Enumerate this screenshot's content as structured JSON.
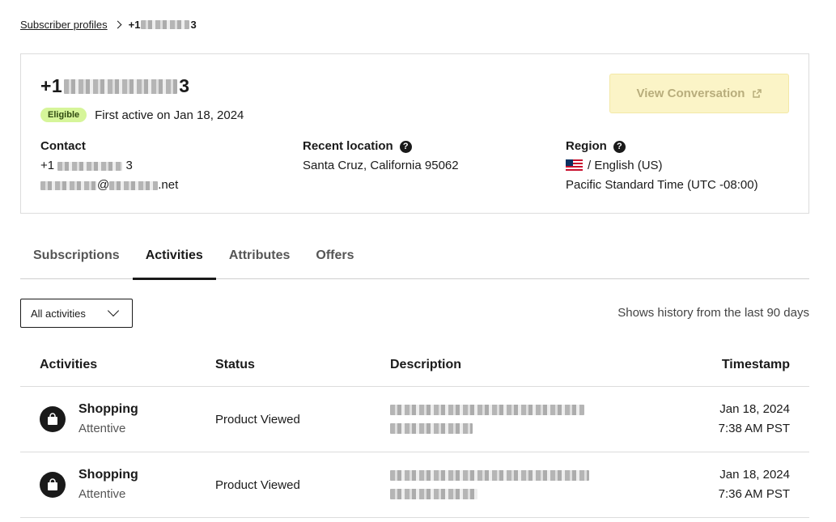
{
  "breadcrumb": {
    "parent": "Subscriber profiles",
    "current_prefix": "+1",
    "current_suffix": "3"
  },
  "profile": {
    "phone_prefix": "+1",
    "phone_suffix": "3",
    "status_badge": "Eligible",
    "first_active": "First active on Jan 18, 2024",
    "view_button": "View Conversation",
    "contact": {
      "heading": "Contact",
      "phone_prefix": "+1",
      "phone_suffix": "3",
      "email_domain": ".net"
    },
    "location": {
      "heading": "Recent location",
      "value": "Santa Cruz, California 95062"
    },
    "region": {
      "heading": "Region",
      "language": "/ English (US)",
      "timezone": "Pacific Standard Time (UTC -08:00)"
    }
  },
  "tabs": [
    {
      "label": "Subscriptions",
      "active": false
    },
    {
      "label": "Activities",
      "active": true
    },
    {
      "label": "Attributes",
      "active": false
    },
    {
      "label": "Offers",
      "active": false
    }
  ],
  "filter": {
    "selected": "All activities",
    "note": "Shows history from the last 90 days"
  },
  "table": {
    "headers": {
      "activities": "Activities",
      "status": "Status",
      "description": "Description",
      "timestamp": "Timestamp"
    },
    "rows": [
      {
        "name": "Shopping",
        "sub": "Attentive",
        "status": "Product Viewed",
        "date": "Jan 18, 2024",
        "time": "7:38 AM PST"
      },
      {
        "name": "Shopping",
        "sub": "Attentive",
        "status": "Product Viewed",
        "date": "Jan 18, 2024",
        "time": "7:36 AM PST"
      }
    ]
  },
  "colors": {
    "badge_bg": "#d6f59a",
    "button_bg": "#fbf4c7",
    "button_text": "#b8ad7c",
    "text": "#1a1a1a"
  },
  "icons": {
    "question": "question-circle-icon",
    "external": "external-link-icon",
    "bag": "shopping-bag-icon",
    "flag": "us-flag-icon"
  }
}
